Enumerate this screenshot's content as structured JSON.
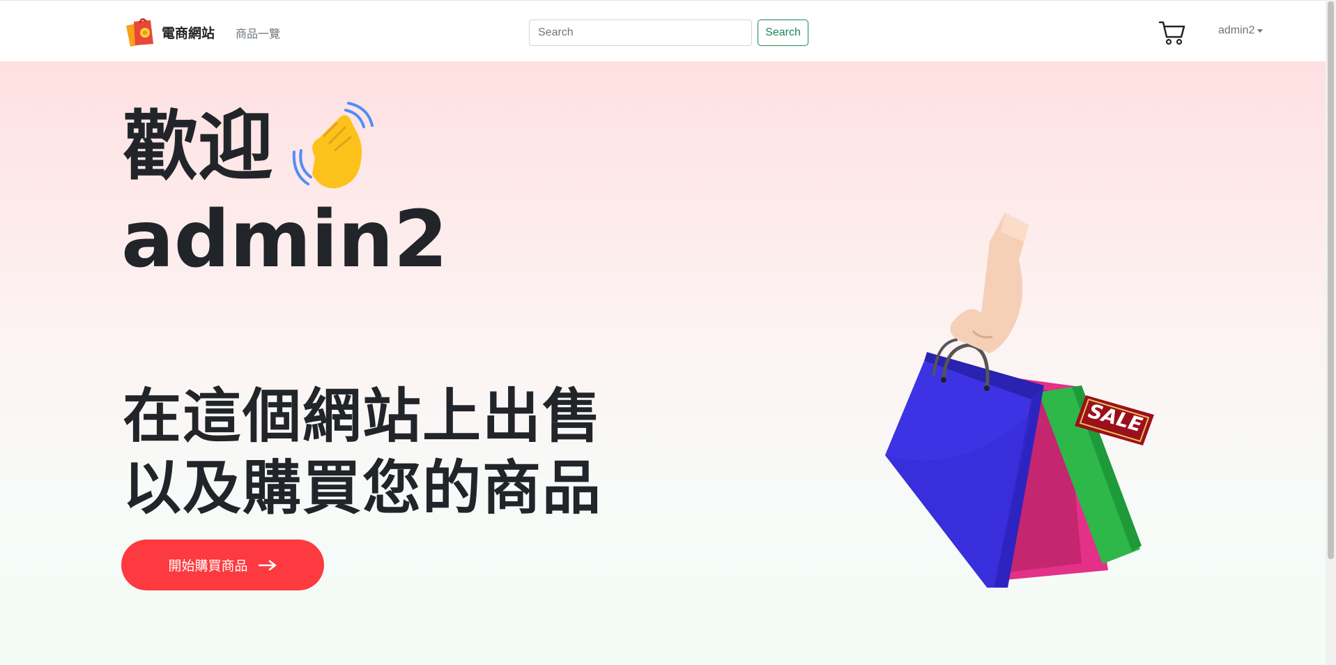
{
  "navbar": {
    "brand_name": "電商網站",
    "nav_link_label": "商品一覽",
    "search": {
      "placeholder": "Search",
      "button_label": "Search"
    },
    "cart_icon": "shopping-cart-icon",
    "user_menu_label": "admin2"
  },
  "hero": {
    "welcome_text": "歡迎",
    "wave_icon": "waving-hand-icon",
    "username": "admin2",
    "tagline_line1": "在這個網站上出售",
    "tagline_line2": "以及購買您的商品",
    "cta_label": "開始購買商品",
    "cta_icon": "arrow-right-icon",
    "illustration_icon": "shopping-bags-illustration",
    "sale_tag_text": "SALE"
  },
  "colors": {
    "accent_red": "#fd3a3f",
    "search_green": "#198754",
    "hero_top": "#fee0e1",
    "hero_bottom": "#f3fbf6"
  }
}
